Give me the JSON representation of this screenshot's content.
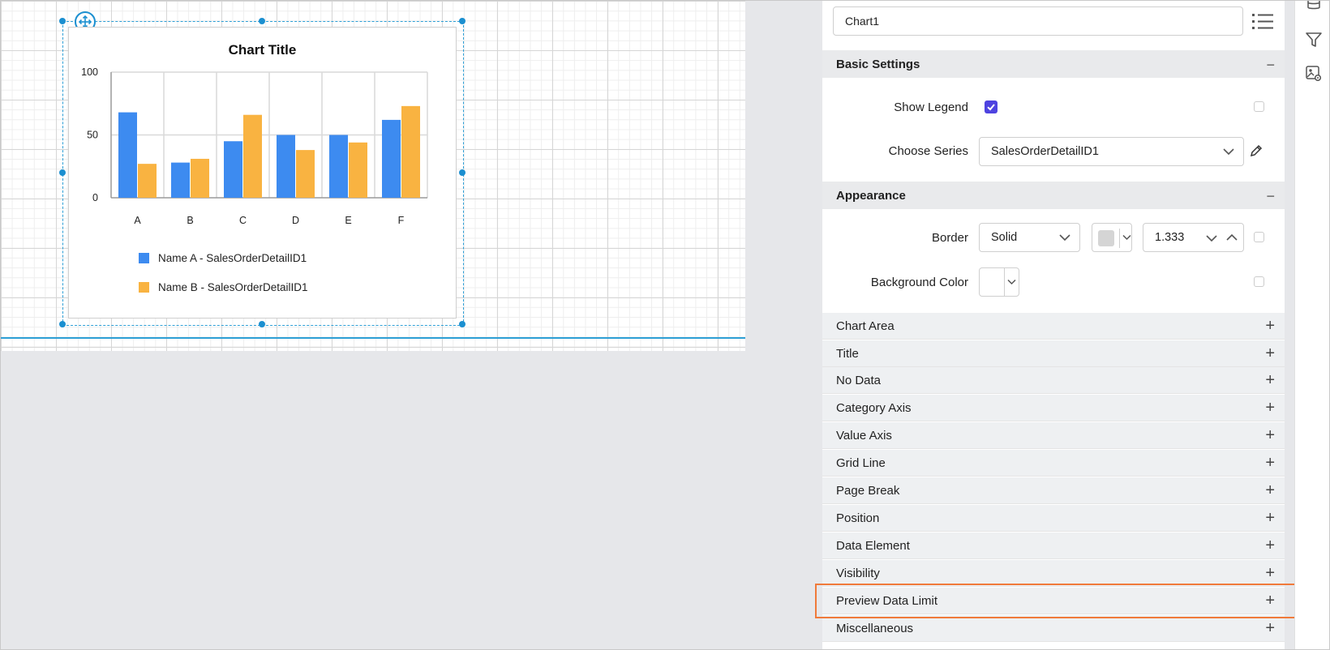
{
  "chart": {
    "title": "Chart Title",
    "legend": [
      {
        "label": "Name A - SalesOrderDetailID1",
        "color": "#3d8bf0"
      },
      {
        "label": "Name B - SalesOrderDetailID1",
        "color": "#f9b341"
      }
    ]
  },
  "chart_data": {
    "type": "bar",
    "title": "Chart Title",
    "categories": [
      "A",
      "B",
      "C",
      "D",
      "E",
      "F"
    ],
    "series": [
      {
        "name": "Name A - SalesOrderDetailID1",
        "values": [
          68,
          28,
          45,
          50,
          50,
          62
        ],
        "color": "#3d8bf0"
      },
      {
        "name": "Name B - SalesOrderDetailID1",
        "values": [
          27,
          31,
          66,
          38,
          44,
          73
        ],
        "color": "#f9b341"
      }
    ],
    "yticks": [
      "100",
      "50",
      "0"
    ],
    "ylim": [
      0,
      100
    ],
    "grid": true,
    "legend_position": "bottom"
  },
  "properties": {
    "item_name": "Chart1",
    "basic": {
      "header": "Basic Settings",
      "show_legend_label": "Show Legend",
      "show_legend_checked": true,
      "choose_series_label": "Choose Series",
      "choose_series_value": "SalesOrderDetailID1"
    },
    "appearance": {
      "header": "Appearance",
      "border_label": "Border",
      "border_style": "Solid",
      "border_width": "1.333",
      "background_label": "Background Color"
    },
    "sections": [
      "Chart Area",
      "Title",
      "No Data",
      "Category Axis",
      "Value Axis",
      "Grid Line",
      "Page Break",
      "Position",
      "Data Element",
      "Visibility",
      "Preview Data Limit",
      "Miscellaneous"
    ],
    "collapse_symbol": "−",
    "expand_symbol": "+"
  },
  "toolbar": {
    "icons": [
      "database-icon",
      "filter-icon",
      "image-settings-icon"
    ]
  }
}
